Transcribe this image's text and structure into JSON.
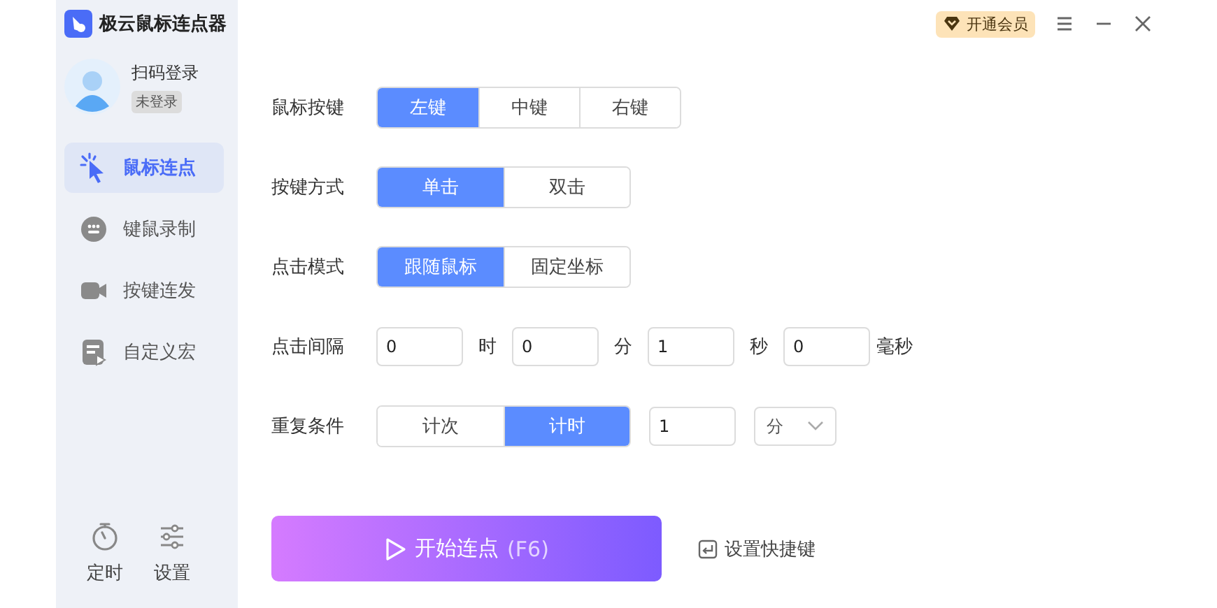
{
  "app": {
    "title": "极云鼠标连点器"
  },
  "user": {
    "name": "扫码登录",
    "status": "未登录"
  },
  "nav": [
    {
      "label": "鼠标连点",
      "selected": true
    },
    {
      "label": "键鼠录制",
      "selected": false
    },
    {
      "label": "按键连发",
      "selected": false
    },
    {
      "label": "自定义宏",
      "selected": false
    }
  ],
  "tools": [
    {
      "label": "定时"
    },
    {
      "label": "设置"
    }
  ],
  "vip": {
    "label": "开通会员"
  },
  "rows": [
    {
      "kind": "segmented",
      "label": "鼠标按键",
      "options": [
        {
          "label": "左键",
          "selected": true
        },
        {
          "label": "中键",
          "selected": false
        },
        {
          "label": "右键",
          "selected": false
        }
      ]
    },
    {
      "kind": "segmented",
      "label": "按键方式",
      "options": [
        {
          "label": "单击",
          "selected": true
        },
        {
          "label": "双击",
          "selected": false
        }
      ]
    },
    {
      "kind": "segmented",
      "label": "点击模式",
      "options": [
        {
          "label": "跟随鼠标",
          "selected": true
        },
        {
          "label": "固定坐标",
          "selected": false
        }
      ]
    },
    {
      "kind": "interval",
      "label": "点击间隔",
      "fields": [
        {
          "value": "0",
          "unit": "时"
        },
        {
          "value": "0",
          "unit": "分"
        },
        {
          "value": "1",
          "unit": "秒"
        },
        {
          "value": "0",
          "unit": "毫秒"
        }
      ]
    },
    {
      "kind": "repeat",
      "label": "重复条件",
      "options": [
        {
          "label": "计次",
          "selected": false
        },
        {
          "label": "计时",
          "selected": true
        }
      ],
      "value": "1",
      "unit": "分"
    }
  ],
  "start": {
    "label": "开始连点",
    "hotkey": "(F6)"
  },
  "shortcut": {
    "label": "设置快捷键"
  }
}
